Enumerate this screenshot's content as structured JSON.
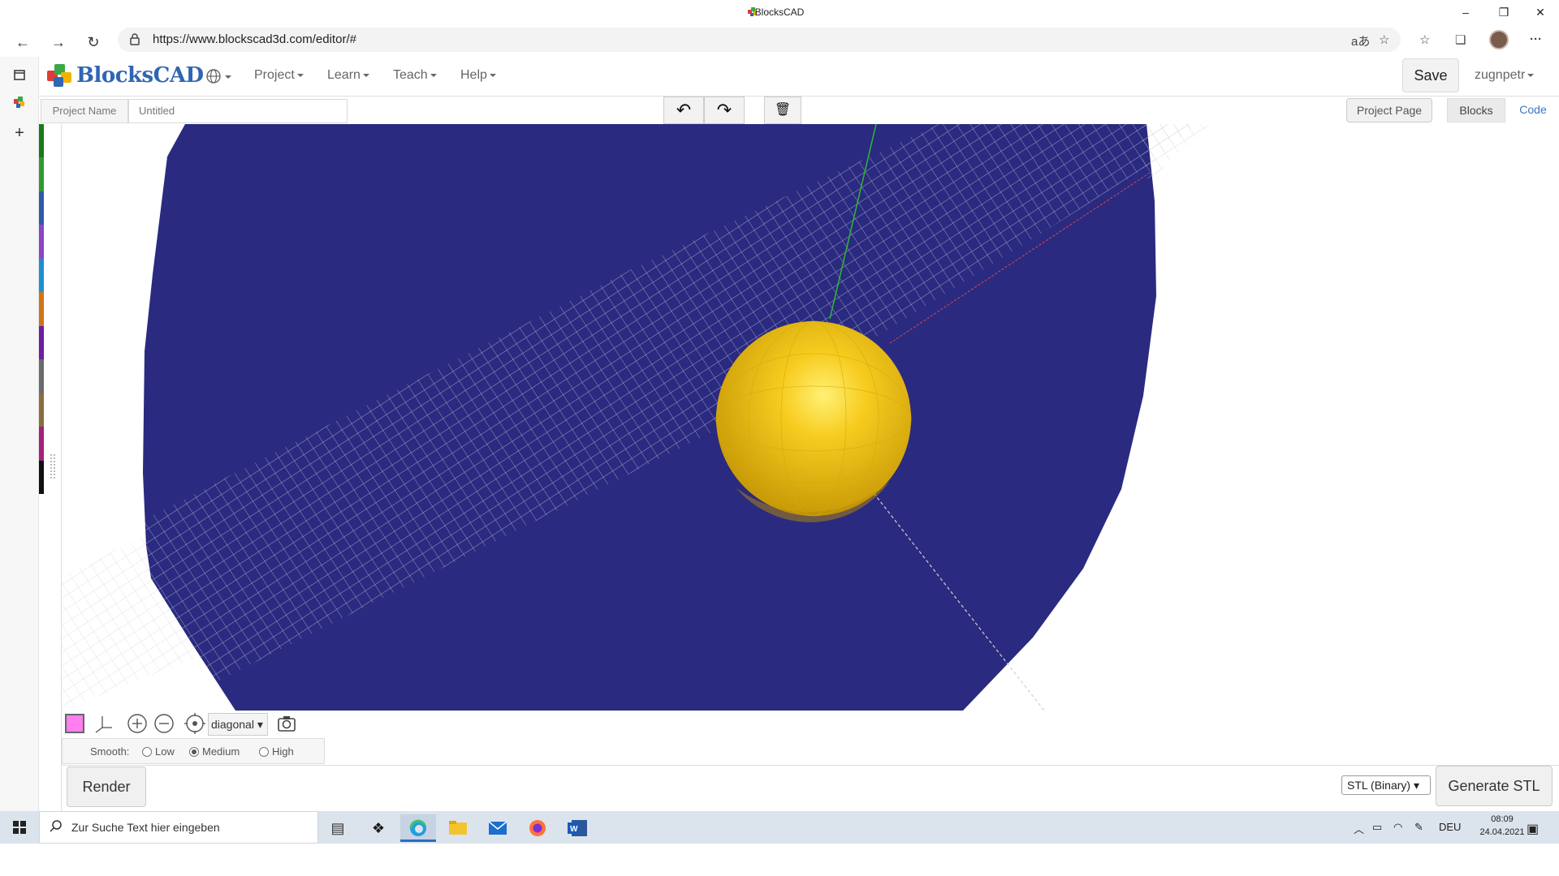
{
  "window": {
    "title": "BlocksCAD",
    "controls": {
      "minimize": "–",
      "restore": "❐",
      "close": "✕"
    }
  },
  "browser": {
    "url": "https://www.blockscad3d.com/editor/#",
    "nav": {
      "back": "←",
      "forward": "→",
      "reload": "↻"
    },
    "icons": {
      "lock": "lock-icon",
      "read_aloud": "aあ",
      "favorite": "☆",
      "favorites_list": "☆",
      "collections": "❏",
      "more": "···"
    }
  },
  "edge_sidebar": {
    "items": [
      "tab-actions-icon",
      "blockscad-tab-icon",
      "new-tab-icon"
    ],
    "new_tab": "+"
  },
  "app": {
    "logo_text": "BlocksCAD",
    "menus": [
      "Project",
      "Learn",
      "Teach",
      "Help"
    ],
    "save_label": "Save",
    "user": "zugnpetr",
    "project_name_label": "Project Name",
    "project_name_value": "Untitled",
    "toolbar": {
      "undo": "↶",
      "redo": "↷",
      "trash": "🗑"
    },
    "project_page_label": "Project Page",
    "tabs": {
      "blocks": "Blocks",
      "code": "Code"
    },
    "category_colors": [
      "#1a7a1a",
      "#2f9a2f",
      "#2c5aa8",
      "#8e44c8",
      "#1d8fd0",
      "#d07418",
      "#6a1fa0",
      "#6b6b6b",
      "#8a6d3f",
      "#a61f7a",
      "#101010"
    ]
  },
  "viewport": {
    "background_color": "#2a2a80",
    "sphere_color": "#f5c518",
    "view_options": [
      "diagonal"
    ],
    "view_selected": "diagonal",
    "object_color": "#ff7ff0",
    "smooth_label": "Smooth:",
    "smooth_options": [
      "Low",
      "Medium",
      "High"
    ],
    "smooth_selected": "Medium"
  },
  "actions": {
    "render_label": "Render",
    "export_format": "STL (Binary)",
    "generate_label": "Generate STL"
  },
  "taskbar": {
    "search_placeholder": "Zur Suche Text hier eingeben",
    "apps": [
      "task-view-icon",
      "dropbox-icon",
      "edge-icon",
      "explorer-icon",
      "mail-icon",
      "firefox-icon",
      "word-icon"
    ],
    "language": "DEU",
    "time": "08:09",
    "date": "24.04.2021"
  }
}
